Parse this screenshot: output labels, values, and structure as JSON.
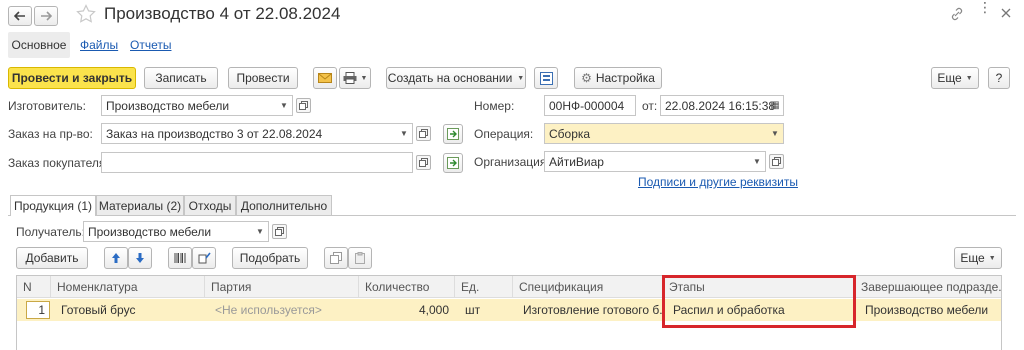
{
  "window": {
    "title": "Производство 4 от 22.08.2024"
  },
  "nav_tabs": {
    "main": "Основное",
    "files": "Файлы",
    "reports": "Отчеты"
  },
  "toolbar": {
    "post_and_close": "Провести и закрыть",
    "save": "Записать",
    "post": "Провести",
    "create_based_on": "Создать на основании",
    "settings": "Настройка",
    "more": "Еще",
    "help": "?"
  },
  "form": {
    "manufacturer_label": "Изготовитель:",
    "manufacturer_value": "Производство мебели",
    "prod_order_label": "Заказ на пр-во:",
    "prod_order_value": "Заказ на производство 3 от 22.08.2024",
    "customer_order_label": "Заказ покупателя:",
    "customer_order_value": "",
    "number_label": "Номер:",
    "number_value": "00НФ-000004",
    "date_label": "от:",
    "date_value": "22.08.2024 16:15:38",
    "operation_label": "Операция:",
    "operation_value": "Сборка",
    "organization_label": "Организация:",
    "organization_value": "АйтиВиар",
    "signatures_link": "Подписи и другие реквизиты"
  },
  "doc_tabs": [
    "Продукция (1)",
    "Материалы (2)",
    "Отходы",
    "Дополнительно"
  ],
  "products": {
    "recipient_label": "Получатель:",
    "recipient_value": "Производство мебели",
    "add_button": "Добавить",
    "select_button": "Подобрать",
    "more_button": "Еще"
  },
  "table": {
    "columns": [
      "N",
      "Номенклатура",
      "Партия",
      "Количество",
      "Ед.",
      "Спецификация",
      "Этапы",
      "Завершающее подразде..."
    ],
    "rows": [
      {
        "n": "1",
        "nomenclature": "Готовый брус",
        "batch": "<Не используется>",
        "quantity": "4,000",
        "unit": "шт",
        "spec": "Изготовление готового б...",
        "stages": "Распил и обработка",
        "final_dept": "Производство мебели"
      }
    ]
  },
  "colors": {
    "primary_button": "#fbe34c",
    "selected_row": "#fdf1c4",
    "highlight_border": "#d7262b",
    "link": "#1a5ab1"
  }
}
